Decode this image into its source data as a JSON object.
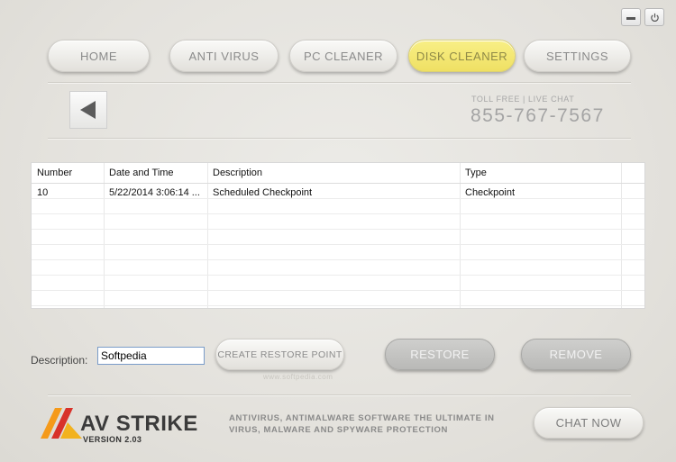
{
  "window": {
    "minimize_icon": "minimize-icon",
    "power_icon": "power-icon"
  },
  "nav": {
    "items": [
      {
        "label": "HOME"
      },
      {
        "label": "ANTI VIRUS"
      },
      {
        "label": "PC CLEANER"
      },
      {
        "label": "DISK CLEANER",
        "active": true
      },
      {
        "label": "SETTINGS"
      }
    ]
  },
  "header": {
    "back_icon": "back-arrow-icon",
    "toll_free": "TOLL FREE | LIVE CHAT",
    "phone": "855-767-7567"
  },
  "table": {
    "columns": [
      "Number",
      "Date and Time",
      "Description",
      "Type"
    ],
    "rows": [
      [
        "10",
        "5/22/2014 3:06:14 ...",
        "Scheduled Checkpoint",
        "Checkpoint"
      ]
    ]
  },
  "actions": {
    "description_label": "Description:",
    "description_value": "Softpedia",
    "create_label": "CREATE RESTORE POINT",
    "restore_label": "RESTORE",
    "remove_label": "REMOVE",
    "watermark": "www.softpedia.com"
  },
  "footer": {
    "logo_av": "AV",
    "logo_strike": "STRIKE",
    "version": "VERSION 2.03",
    "tagline": "ANTIVIRUS, ANTIMALWARE SOFTWARE THE ULTIMATE IN VIRUS, MALWARE AND SPYWARE PROTECTION",
    "chat_label": "CHAT NOW"
  },
  "colors": {
    "background": "#e6e4df",
    "active_tab": "#f4e675",
    "logo_orange": "#f59a1a",
    "logo_red": "#d8322a"
  }
}
